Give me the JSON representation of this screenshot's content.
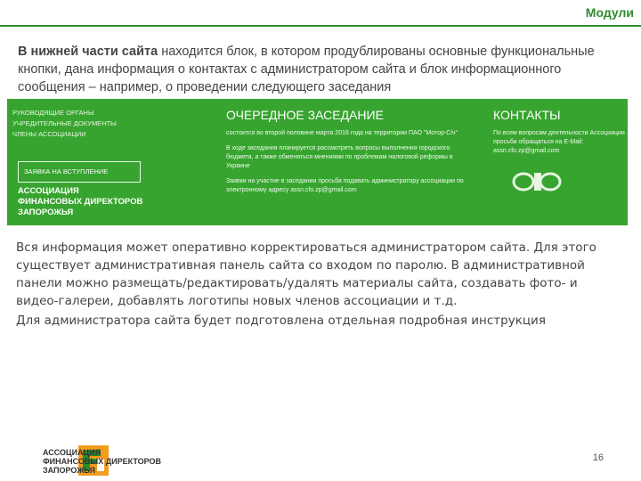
{
  "slide": {
    "title": "Модули",
    "intro_bold": "В нижней части сайта",
    "intro_rest": " находится блок, в котором продублированы основные функциональные кнопки, дана информация о контактах с администратором сайта и блок информационного сообщения – например, о проведении следующего заседания",
    "page_number": "16"
  },
  "footer_screenshot": {
    "menu": [
      "Руководящие органы",
      "Учредительные документы",
      "Члены ассоциации"
    ],
    "join_button": "Заявка на вступление",
    "association_name_line1": "Ассоциация",
    "association_name_line2": "финансовых директоров Запорожья",
    "meeting_heading": "Очередное заседание",
    "meeting_p1": "состоится во второй половине марта 2016 года на территории ПАО \"Мотор-Січ\"",
    "meeting_p2": "В ходе заседания планируется рассмотреть вопросы выполнения городского бюджета, а также обменяться мнениями по проблемам налоговой реформы в Украине",
    "meeting_p3": "Заявки на участие в заседании просьба подавать администратору ассоциации по электронному адресу assn.cfo.zp@gmail.com",
    "contacts_heading": "Контакты",
    "contacts_p": "По всем вопросам деятельности Ассоциации просьба обращаться на E-Mail: assn.cfo.zp@gmail.com"
  },
  "body": {
    "paragraph1": "Вся информация может оперативно корректироваться администратором сайта. Для этого существует административная панель сайта со входом по паролю. В административной панели можно размещать/редактировать/удалять материалы сайта, создавать фото- и видео-галереи, добавлять логотипы новых членов ассоциации и т.д.",
    "paragraph2": "Для администратора сайта будет подготовлена отдельная подробная инструкция"
  },
  "logo": {
    "line1": "АССОЦИАЦИЯ",
    "line2": "ФИНАНСОВЫХ ДИРЕКТОРОВ",
    "line3": "ЗАПОРОЖЬЯ"
  },
  "colors": {
    "accent_green": "#37a42f",
    "title_green": "#2e8b2e",
    "logo_orange": "#f39c1e"
  }
}
